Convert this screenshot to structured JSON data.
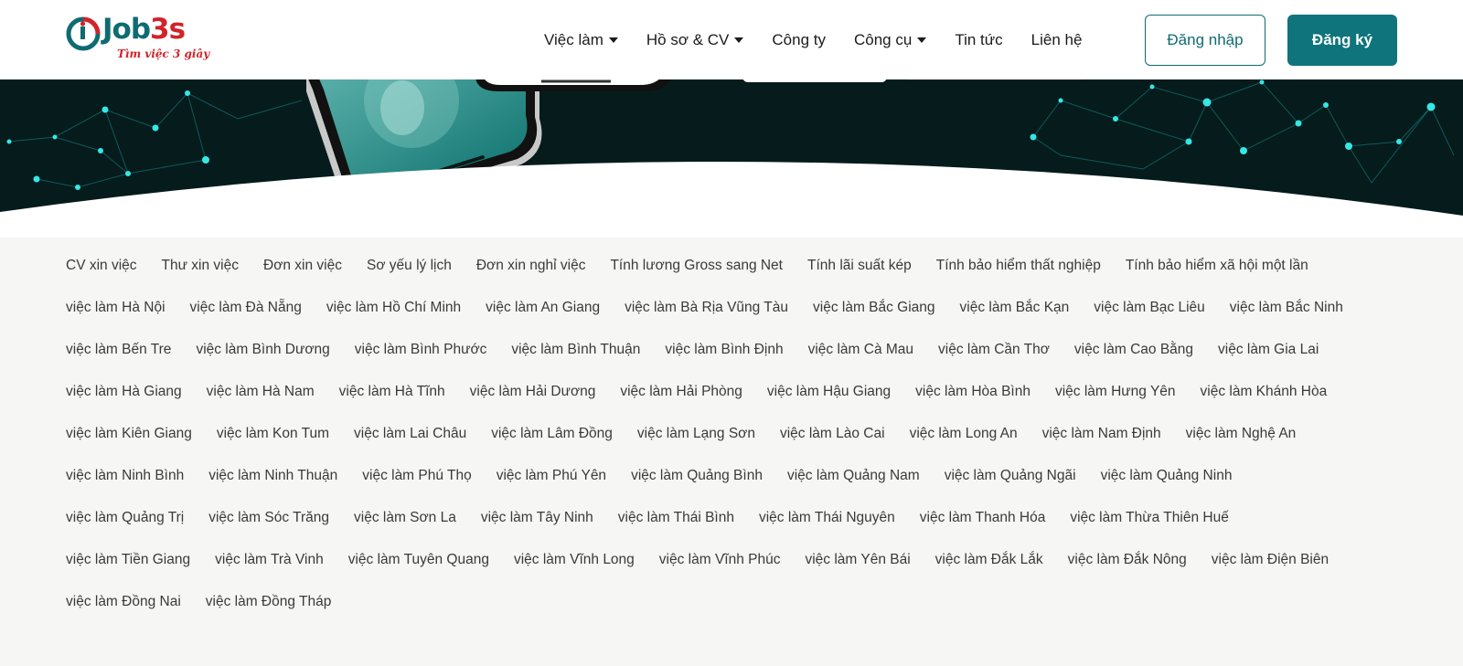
{
  "brand": {
    "name_part1": "Job",
    "name_part2": "3s",
    "tagline": "Tìm việc 3 giây",
    "primary_color": "#0f747c",
    "accent_color": "#d1232a"
  },
  "nav": {
    "items": [
      {
        "label": "Việc làm",
        "dropdown": true
      },
      {
        "label": "Hồ sơ & CV",
        "dropdown": true
      },
      {
        "label": "Công ty",
        "dropdown": false
      },
      {
        "label": "Công cụ",
        "dropdown": true
      },
      {
        "label": "Tin tức",
        "dropdown": false
      },
      {
        "label": "Liên hệ",
        "dropdown": false
      }
    ],
    "login_label": "Đăng nhập",
    "register_label": "Đăng ký"
  },
  "links": {
    "rows": [
      [
        "CV xin việc",
        "Thư xin việc",
        "Đơn xin việc",
        "Sơ yếu lý lịch",
        "Đơn xin nghỉ việc",
        "Tính lương Gross sang Net",
        "Tính lãi suất kép",
        "Tính bảo hiểm thất nghiệp",
        "Tính bảo hiểm xã hội một lần"
      ],
      [
        "việc làm Hà Nội",
        "việc làm Đà Nẵng",
        "việc làm Hồ Chí Minh",
        "việc làm An Giang",
        "việc làm Bà Rịa Vũng Tàu",
        "việc làm Bắc Giang",
        "việc làm Bắc Kạn",
        "việc làm Bạc Liêu",
        "việc làm Bắc Ninh"
      ],
      [
        "việc làm Bến Tre",
        "việc làm Bình Dương",
        "việc làm Bình Phước",
        "việc làm Bình Thuận",
        "việc làm Bình Định",
        "việc làm Cà Mau",
        "việc làm Cần Thơ",
        "việc làm Cao Bằng",
        "việc làm Gia Lai"
      ],
      [
        "việc làm Hà Giang",
        "việc làm Hà Nam",
        "việc làm Hà Tĩnh",
        "việc làm Hải Dương",
        "việc làm Hải Phòng",
        "việc làm Hậu Giang",
        "việc làm Hòa Bình",
        "việc làm Hưng Yên",
        "việc làm Khánh Hòa"
      ],
      [
        "việc làm Kiên Giang",
        "việc làm Kon Tum",
        "việc làm Lai Châu",
        "việc làm Lâm Đồng",
        "việc làm Lạng Sơn",
        "việc làm Lào Cai",
        "việc làm Long An",
        "việc làm Nam Định",
        "việc làm Nghệ An"
      ],
      [
        "việc làm Ninh Bình",
        "việc làm Ninh Thuận",
        "việc làm Phú Thọ",
        "việc làm Phú Yên",
        "việc làm Quảng Bình",
        "việc làm Quảng Nam",
        "việc làm Quảng Ngãi",
        "việc làm Quảng Ninh"
      ],
      [
        "việc làm Quảng Trị",
        "việc làm Sóc Trăng",
        "việc làm Sơn La",
        "việc làm Tây Ninh",
        "việc làm Thái Bình",
        "việc làm Thái Nguyên",
        "việc làm Thanh Hóa",
        "việc làm Thừa Thiên Huế"
      ],
      [
        "việc làm Tiền Giang",
        "việc làm Trà Vinh",
        "việc làm Tuyên Quang",
        "việc làm Vĩnh Long",
        "việc làm Vĩnh Phúc",
        "việc làm Yên Bái",
        "việc làm Đắk Lắk",
        "việc làm Đắk Nông",
        "việc làm Điện Biên"
      ],
      [
        "việc làm Đồng Nai",
        "việc làm Đồng Tháp"
      ]
    ]
  }
}
